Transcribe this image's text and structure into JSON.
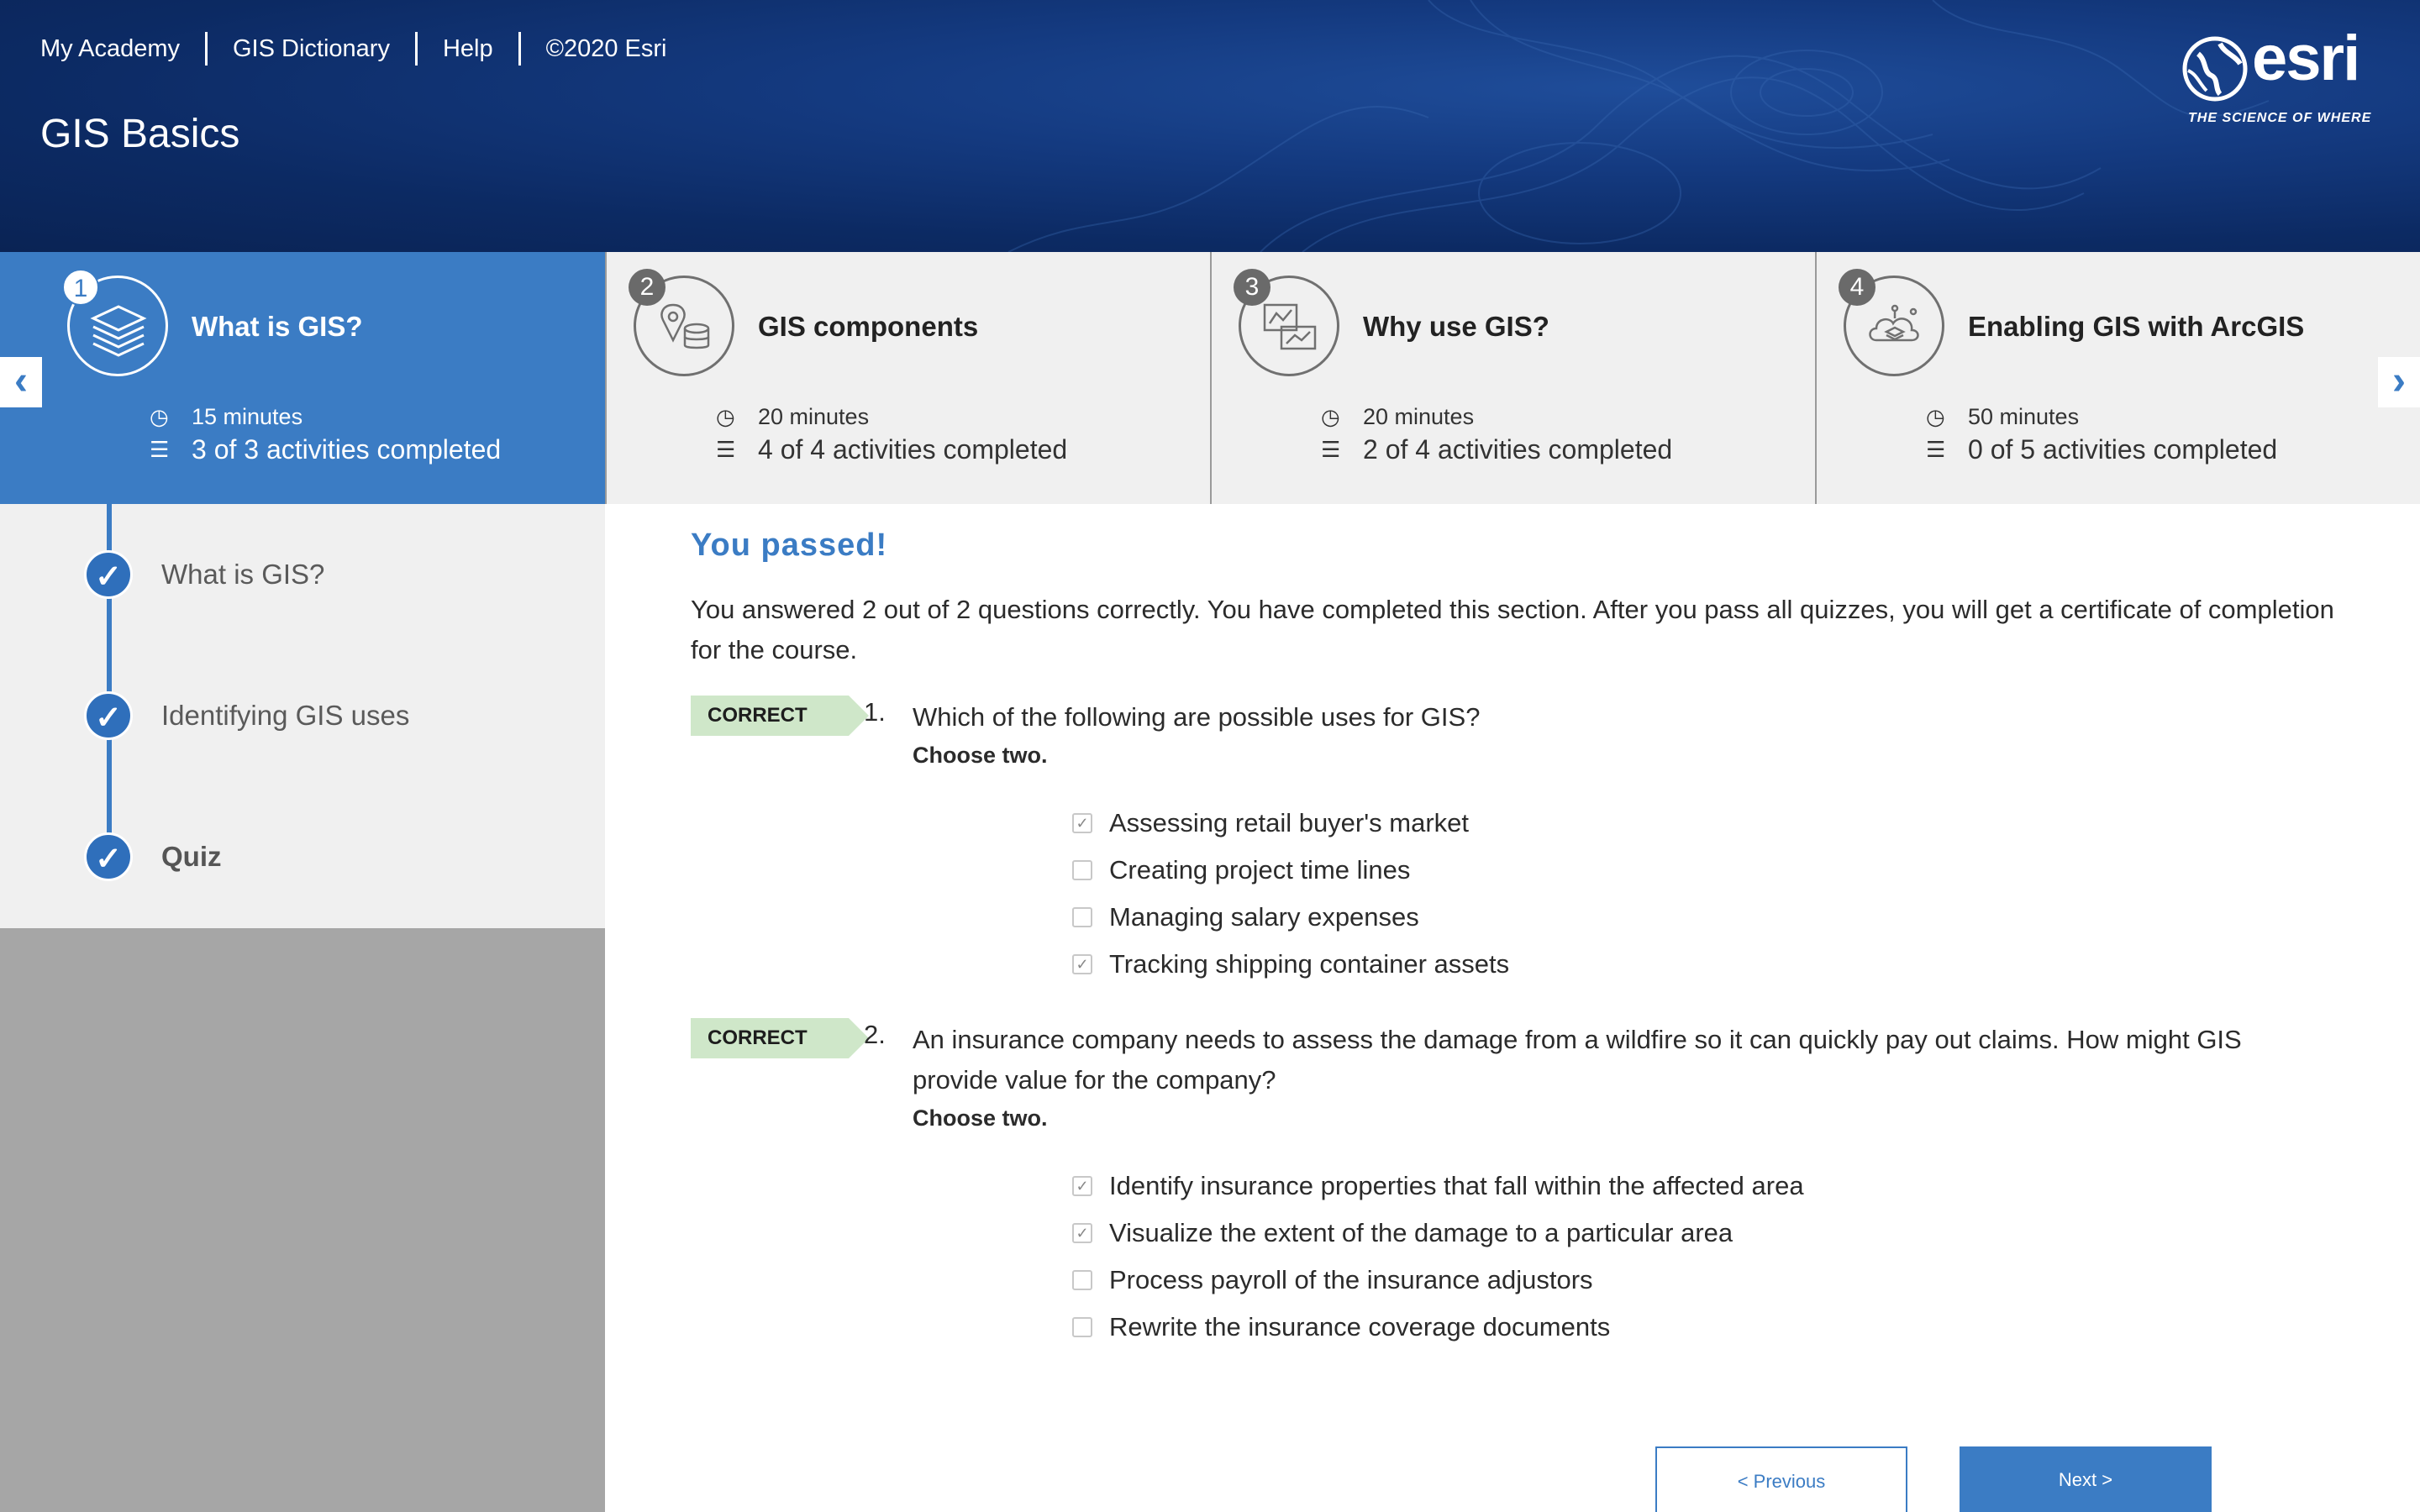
{
  "header": {
    "nav": [
      "My Academy",
      "GIS Dictionary",
      "Help",
      "©2020 Esri"
    ],
    "course_title": "GIS Basics",
    "logo_word": "esri",
    "logo_tagline": "THE SCIENCE OF WHERE"
  },
  "modules": [
    {
      "num": "1",
      "title": "What is GIS?",
      "duration": "15 minutes",
      "progress": "3 of 3 activities completed",
      "active": true
    },
    {
      "num": "2",
      "title": "GIS components",
      "duration": "20 minutes",
      "progress": "4 of 4 activities completed",
      "active": false
    },
    {
      "num": "3",
      "title": "Why use GIS?",
      "duration": "20 minutes",
      "progress": "2 of 4 activities completed",
      "active": false
    },
    {
      "num": "4",
      "title": "Enabling GIS with ArcGIS",
      "duration": "50 minutes",
      "progress": "0 of 5 activities completed",
      "active": false
    }
  ],
  "sidebar": {
    "items": [
      {
        "label": "What is GIS?",
        "completed": true
      },
      {
        "label": "Identifying GIS uses",
        "completed": true
      },
      {
        "label": "Quiz",
        "completed": true
      }
    ]
  },
  "result": {
    "heading": "You passed!",
    "summary": "You answered 2 out of 2 questions correctly. You have completed this section. After you pass all quizzes, you will get a certificate of completion for the course."
  },
  "questions": [
    {
      "badge": "CORRECT",
      "number": "1.",
      "text": "Which of the following are possible uses for GIS?",
      "instruction": "Choose two",
      "options": [
        {
          "label": "Assessing retail buyer's market",
          "checked": true
        },
        {
          "label": "Creating project time lines",
          "checked": false
        },
        {
          "label": "Managing salary expenses",
          "checked": false
        },
        {
          "label": "Tracking shipping container assets",
          "checked": true
        }
      ]
    },
    {
      "badge": "CORRECT",
      "number": "2.",
      "text": "An insurance company needs to assess the damage from a wildfire so it can quickly pay out claims. How might GIS provide value for the company?",
      "instruction": "Choose two",
      "options": [
        {
          "label": "Identify insurance properties that fall within the affected area",
          "checked": true
        },
        {
          "label": "Visualize the extent of the damage to a particular area",
          "checked": true
        },
        {
          "label": "Process payroll of the insurance adjustors",
          "checked": false
        },
        {
          "label": "Rewrite the insurance coverage documents",
          "checked": false
        }
      ]
    }
  ],
  "buttons": {
    "previous": "< Previous",
    "next": "Next >"
  },
  "icons": {
    "left_arrow": "chevron-left-icon",
    "right_arrow": "chevron-right-icon",
    "clock": "clock-icon",
    "list": "list-icon",
    "check": "check-icon"
  },
  "colors": {
    "accent": "#3b7cc4",
    "header_bg": "#0c2a63",
    "correct_badge": "#cfe7c9",
    "sidebar_bg": "#f0f0f0"
  }
}
